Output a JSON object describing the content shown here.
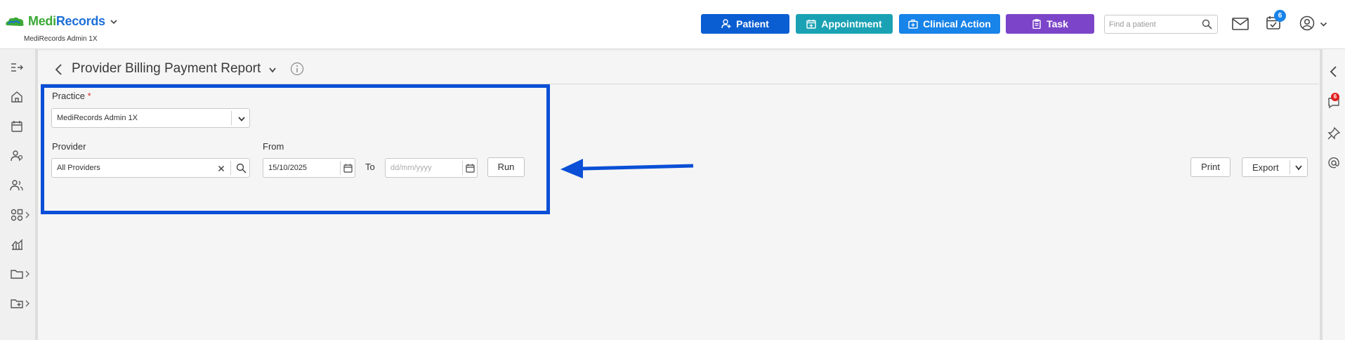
{
  "brand": {
    "name_part1": "Medi",
    "name_part2": "Records",
    "subtitle": "MediRecords Admin 1X"
  },
  "topbar": {
    "buttons": [
      {
        "label": "Patient",
        "icon": "user-plus-icon",
        "color": "#0a5ed2"
      },
      {
        "label": "Appointment",
        "icon": "calendar-plus-icon",
        "color": "#1aa2b4"
      },
      {
        "label": "Clinical Action",
        "icon": "medical-case-icon",
        "color": "#1883e8"
      },
      {
        "label": "Task",
        "icon": "clipboard-icon",
        "color": "#7c45c9"
      }
    ],
    "search_placeholder": "Find a patient",
    "calendar_badge": "6"
  },
  "right_sidebar": {
    "chat_badge": "6"
  },
  "page": {
    "title": "Provider Billing Payment Report"
  },
  "form": {
    "practice_label": "Practice",
    "practice_required": "*",
    "practice_value": "MediRecords Admin 1X",
    "provider_label": "Provider",
    "provider_value": "All Providers",
    "from_label": "From",
    "from_value": "15/10/2025",
    "to_label": "To",
    "to_placeholder": "dd/mm/yyyy",
    "run_label": "Run"
  },
  "actions": {
    "print_label": "Print",
    "export_label": "Export"
  },
  "annotation": {
    "highlight_color": "#0a4fd6"
  }
}
